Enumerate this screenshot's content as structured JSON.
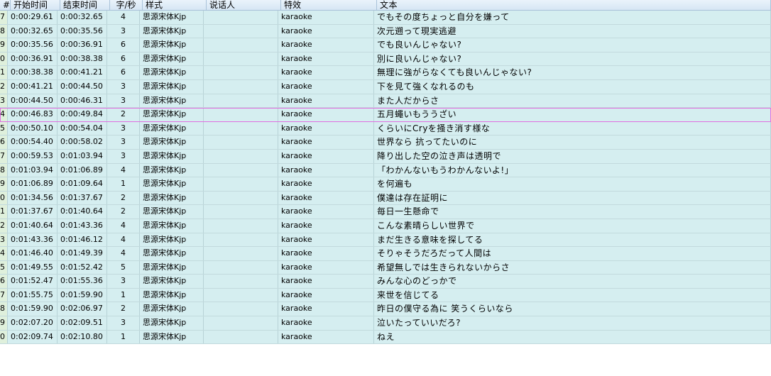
{
  "columns": {
    "num": "#",
    "start": "开始时间",
    "end": "结束时间",
    "cps": "字/秒",
    "style": "样式",
    "actor": "说话人",
    "effect": "特效",
    "text": "文本"
  },
  "rows": [
    {
      "num": "7",
      "start": "0:00:29.61",
      "end": "0:00:32.65",
      "cps": "4",
      "style": "思源宋体Kjp",
      "actor": "",
      "effect": "karaoke",
      "text": "でもその度ちょっと自分を嫌って"
    },
    {
      "num": "8",
      "start": "0:00:32.65",
      "end": "0:00:35.56",
      "cps": "3",
      "style": "思源宋体Kjp",
      "actor": "",
      "effect": "karaoke",
      "text": "次元遡って現実逃避"
    },
    {
      "num": "9",
      "start": "0:00:35.56",
      "end": "0:00:36.91",
      "cps": "6",
      "style": "思源宋体Kjp",
      "actor": "",
      "effect": "karaoke",
      "text": "でも良いんじゃない?"
    },
    {
      "num": "0",
      "start": "0:00:36.91",
      "end": "0:00:38.38",
      "cps": "6",
      "style": "思源宋体Kjp",
      "actor": "",
      "effect": "karaoke",
      "text": "別に良いんじゃない?"
    },
    {
      "num": "1",
      "start": "0:00:38.38",
      "end": "0:00:41.21",
      "cps": "6",
      "style": "思源宋体Kjp",
      "actor": "",
      "effect": "karaoke",
      "text": "無理に強がらなくても良いんじゃない?"
    },
    {
      "num": "2",
      "start": "0:00:41.21",
      "end": "0:00:44.50",
      "cps": "3",
      "style": "思源宋体Kjp",
      "actor": "",
      "effect": "karaoke",
      "text": "下を見て強くなれるのも"
    },
    {
      "num": "3",
      "start": "0:00:44.50",
      "end": "0:00:46.31",
      "cps": "3",
      "style": "思源宋体Kjp",
      "actor": "",
      "effect": "karaoke",
      "text": "また人だからさ"
    },
    {
      "num": "4",
      "start": "0:00:46.83",
      "end": "0:00:49.84",
      "cps": "2",
      "style": "思源宋体Kjp",
      "actor": "",
      "effect": "karaoke",
      "text": "五月蠅いもううざい",
      "selected": true
    },
    {
      "num": "5",
      "start": "0:00:50.10",
      "end": "0:00:54.04",
      "cps": "3",
      "style": "思源宋体Kjp",
      "actor": "",
      "effect": "karaoke",
      "text": "くらいにCryを掻き消す様な"
    },
    {
      "num": "6",
      "start": "0:00:54.40",
      "end": "0:00:58.02",
      "cps": "3",
      "style": "思源宋体Kjp",
      "actor": "",
      "effect": "karaoke",
      "text": "世界なら 抗ってたいのに"
    },
    {
      "num": "7",
      "start": "0:00:59.53",
      "end": "0:01:03.94",
      "cps": "3",
      "style": "思源宋体Kjp",
      "actor": "",
      "effect": "karaoke",
      "text": "降り出した空の泣き声は透明で"
    },
    {
      "num": "8",
      "start": "0:01:03.94",
      "end": "0:01:06.89",
      "cps": "4",
      "style": "思源宋体Kjp",
      "actor": "",
      "effect": "karaoke",
      "text": "「わかんないもうわかんないよ!」"
    },
    {
      "num": "9",
      "start": "0:01:06.89",
      "end": "0:01:09.64",
      "cps": "1",
      "style": "思源宋体Kjp",
      "actor": "",
      "effect": "karaoke",
      "text": "を何遍も"
    },
    {
      "num": "0",
      "start": "0:01:34.56",
      "end": "0:01:37.67",
      "cps": "2",
      "style": "思源宋体Kjp",
      "actor": "",
      "effect": "karaoke",
      "text": "僕達は存在証明に"
    },
    {
      "num": "1",
      "start": "0:01:37.67",
      "end": "0:01:40.64",
      "cps": "2",
      "style": "思源宋体Kjp",
      "actor": "",
      "effect": "karaoke",
      "text": "毎日一生懸命で"
    },
    {
      "num": "2",
      "start": "0:01:40.64",
      "end": "0:01:43.36",
      "cps": "4",
      "style": "思源宋体Kjp",
      "actor": "",
      "effect": "karaoke",
      "text": "こんな素晴らしい世界で"
    },
    {
      "num": "3",
      "start": "0:01:43.36",
      "end": "0:01:46.12",
      "cps": "4",
      "style": "思源宋体Kjp",
      "actor": "",
      "effect": "karaoke",
      "text": "まだ生きる意味を探してる"
    },
    {
      "num": "4",
      "start": "0:01:46.40",
      "end": "0:01:49.39",
      "cps": "4",
      "style": "思源宋体Kjp",
      "actor": "",
      "effect": "karaoke",
      "text": "そりゃそうだろだって人間は"
    },
    {
      "num": "5",
      "start": "0:01:49.55",
      "end": "0:01:52.42",
      "cps": "5",
      "style": "思源宋体Kjp",
      "actor": "",
      "effect": "karaoke",
      "text": "希望無しでは生きられないからさ"
    },
    {
      "num": "6",
      "start": "0:01:52.47",
      "end": "0:01:55.36",
      "cps": "3",
      "style": "思源宋体Kjp",
      "actor": "",
      "effect": "karaoke",
      "text": "みんな心のどっかで"
    },
    {
      "num": "7",
      "start": "0:01:55.75",
      "end": "0:01:59.90",
      "cps": "1",
      "style": "思源宋体Kjp",
      "actor": "",
      "effect": "karaoke",
      "text": "来世を信じてる"
    },
    {
      "num": "8",
      "start": "0:01:59.90",
      "end": "0:02:06.97",
      "cps": "2",
      "style": "思源宋体Kjp",
      "actor": "",
      "effect": "karaoke",
      "text": "昨日の僕守る為に 笑うくらいなら"
    },
    {
      "num": "9",
      "start": "0:02:07.20",
      "end": "0:02:09.51",
      "cps": "3",
      "style": "思源宋体Kjp",
      "actor": "",
      "effect": "karaoke",
      "text": "泣いたっていいだろ?"
    },
    {
      "num": "0",
      "start": "0:02:09.74",
      "end": "0:02:10.80",
      "cps": "1",
      "style": "思源宋体Kjp",
      "actor": "",
      "effect": "karaoke",
      "text": "ねえ"
    }
  ]
}
